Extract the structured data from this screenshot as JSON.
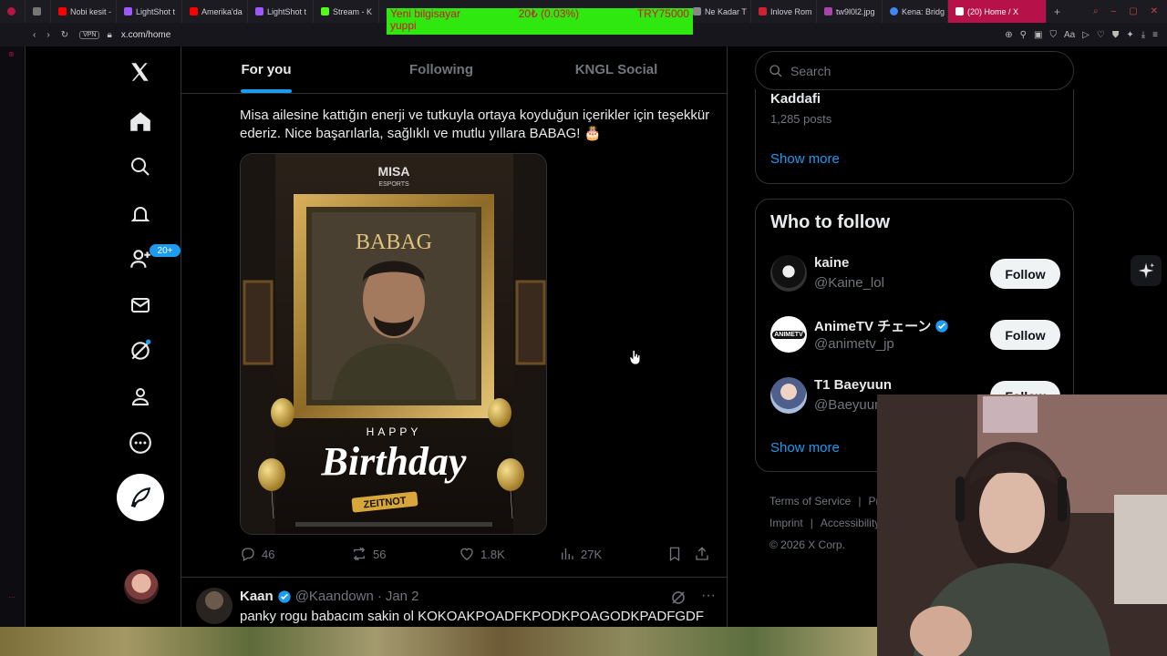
{
  "browser": {
    "tabs": [
      {
        "label": "",
        "color": "#b31545"
      },
      {
        "label": "",
        "color": "#777777"
      },
      {
        "label": "Nobi kesit -",
        "color": "#ff0000"
      },
      {
        "label": "LightShot t",
        "color": "#9b59ff"
      },
      {
        "label": "Amerika'da",
        "color": "#ff0000"
      },
      {
        "label": "LightShot t",
        "color": "#9b59ff"
      },
      {
        "label": "Stream - K",
        "color": "#53fc18"
      },
      {
        "label": "Ne Kadar T",
        "color": "#888888"
      },
      {
        "label": "Inlove Rom",
        "color": "#cc2233"
      },
      {
        "label": "tw9l0l2.jpg",
        "color": "#aa44aa"
      },
      {
        "label": "Kena: Bridg",
        "color": "#4285f4"
      }
    ],
    "active_tab": "(20) Home / X",
    "vpn_label": "VPN",
    "url": "x.com/home"
  },
  "donation": {
    "line1_left": "Yeni bilgisayar",
    "line1_mid": "20₺ (0.03%)",
    "line1_right": "TRY75000",
    "line2": "yuppi"
  },
  "nav": {
    "notifications_badge": "20+"
  },
  "main": {
    "tabs": [
      "For you",
      "Following",
      "KNGL Social"
    ],
    "selected_tab": "For you",
    "tweet": {
      "text": "Misa ailesine kattığın enerji ve tutkuyla ortaya koyduğun içerikler için teşekkür ederiz. Nice başarılarla, sağlıklı ve mutlu yıllara BABAG! 🎂",
      "image": {
        "logo_top": "MISA",
        "logo_bottom": "ESPORTS",
        "plaque": "BABAG",
        "happy": "HAPPY",
        "birthday": "Birthday",
        "ribbon": "ZEITNOT"
      },
      "replies": "46",
      "reposts": "56",
      "likes": "1.8K",
      "views": "27K"
    },
    "tweet2": {
      "name": "Kaan",
      "handle": "@Kaandown",
      "dot": "·",
      "date": "Jan 2",
      "text": "panky rogu babacım sakin ol KOKOAKPOADFKPODKPOAGODKPADFGDF"
    }
  },
  "right": {
    "search_placeholder": "Search",
    "trend": {
      "name": "Kaddafi",
      "count": "1,285 posts",
      "show_more": "Show more"
    },
    "who_to_follow": {
      "title": "Who to follow",
      "users": [
        {
          "name": "kaine",
          "handle": "@Kaine_lol",
          "verified": false,
          "follow": "Follow",
          "avatar": "#222222"
        },
        {
          "name": "AnimeTV チェーン",
          "handle": "@animetv_jp",
          "verified": true,
          "follow": "Follow",
          "avatar": "#ffffff"
        },
        {
          "name": "T1 Baeyuun",
          "handle": "@Baeyuun",
          "verified": false,
          "follow": "Follow",
          "avatar": "#8fa6c8"
        }
      ],
      "show_more": "Show more"
    },
    "footer": {
      "terms": "Terms of Service",
      "privacy": "Priv",
      "imprint": "Imprint",
      "accessibility": "Accessibility",
      "copyright": "© 2026 X Corp."
    }
  },
  "colors": {
    "accent": "#1d9bf0",
    "background": "#000000",
    "border": "#2f3336",
    "muted": "#71767b",
    "opera": "#b31545"
  }
}
